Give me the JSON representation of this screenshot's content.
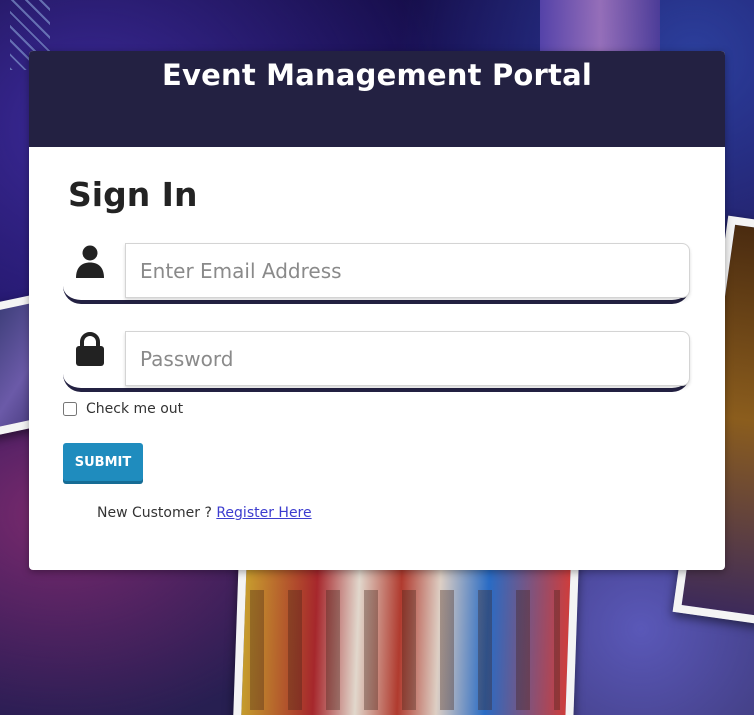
{
  "header": {
    "title": "Event Management Portal"
  },
  "form": {
    "heading": "Sign In",
    "email": {
      "placeholder": "Enter Email Address",
      "value": "",
      "icon": "user-icon"
    },
    "password": {
      "placeholder": "Password",
      "value": "",
      "icon": "lock-icon"
    },
    "remember_label": "Check me out",
    "remember_checked": false,
    "submit_label": "SUBMIT",
    "register_prompt": "New Customer ?",
    "register_link": "Register Here"
  },
  "colors": {
    "header_bg": "#232142",
    "submit_bg": "#1f8cbe",
    "link": "#3c3ccf"
  }
}
